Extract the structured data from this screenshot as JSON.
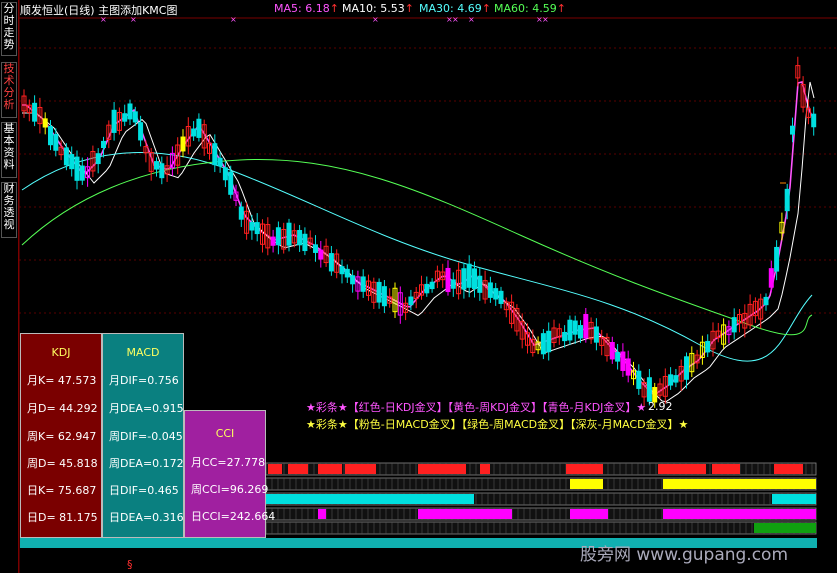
{
  "header": {
    "title": "顺发恒业(日线) 主图添加KMC图",
    "ma": [
      {
        "label": "MA5: 6.18",
        "arrow": "↑",
        "color": "#ff55ff"
      },
      {
        "label": "MA10: 5.53",
        "arrow": "↑",
        "color": "#ffffff"
      },
      {
        "label": "MA30: 4.69",
        "arrow": "↑",
        "color": "#55ffff"
      },
      {
        "label": "MA60: 4.59",
        "arrow": "↑",
        "color": "#55ff55"
      }
    ]
  },
  "side_tabs": [
    {
      "label": "分时走势",
      "active": false
    },
    {
      "label": "技术分析",
      "active": true
    },
    {
      "label": "基本资料",
      "active": false
    },
    {
      "label": "财务透视",
      "active": false
    }
  ],
  "chart_data": {
    "type": "candlestick",
    "low_marker": "2.92",
    "colors": {
      "up": "#ff2020",
      "down": "#00e0e0",
      "ma5": "#ff55ff",
      "ma10": "#ffffff",
      "ma30": "#55ffff",
      "ma60": "#55ff55",
      "up_alt": "#ffff00",
      "down_alt": "#ff00ff"
    }
  },
  "kdj": {
    "title": "KDJ",
    "rows": [
      "月K= 47.573",
      "月D= 44.292",
      "周K= 62.947",
      "周D= 45.818",
      "日K= 75.687",
      "日D= 81.175"
    ]
  },
  "macd": {
    "title": "MACD",
    "rows": [
      "月DIF=0.756",
      "月DEA=0.915",
      "周DIF=-0.045",
      "周DEA=0.172",
      "日DIF=0.465",
      "日DEA=0.316"
    ]
  },
  "cci": {
    "title": "CCI",
    "rows": [
      "月CC=27.778",
      "周CCI=96.269",
      "日CCI=242.664"
    ]
  },
  "legend": {
    "line1": "★彩条★【红色-日KDJ金叉】【黄色-周KDJ金叉】【青色-月KDJ金叉】★",
    "line2": "★彩条★【粉色-日MACD金叉】【绿色-周MACD金叉】【深灰-月MACD金叉】★"
  },
  "bottom_marker": "§",
  "watermark": "股旁网  www.gupang.com"
}
